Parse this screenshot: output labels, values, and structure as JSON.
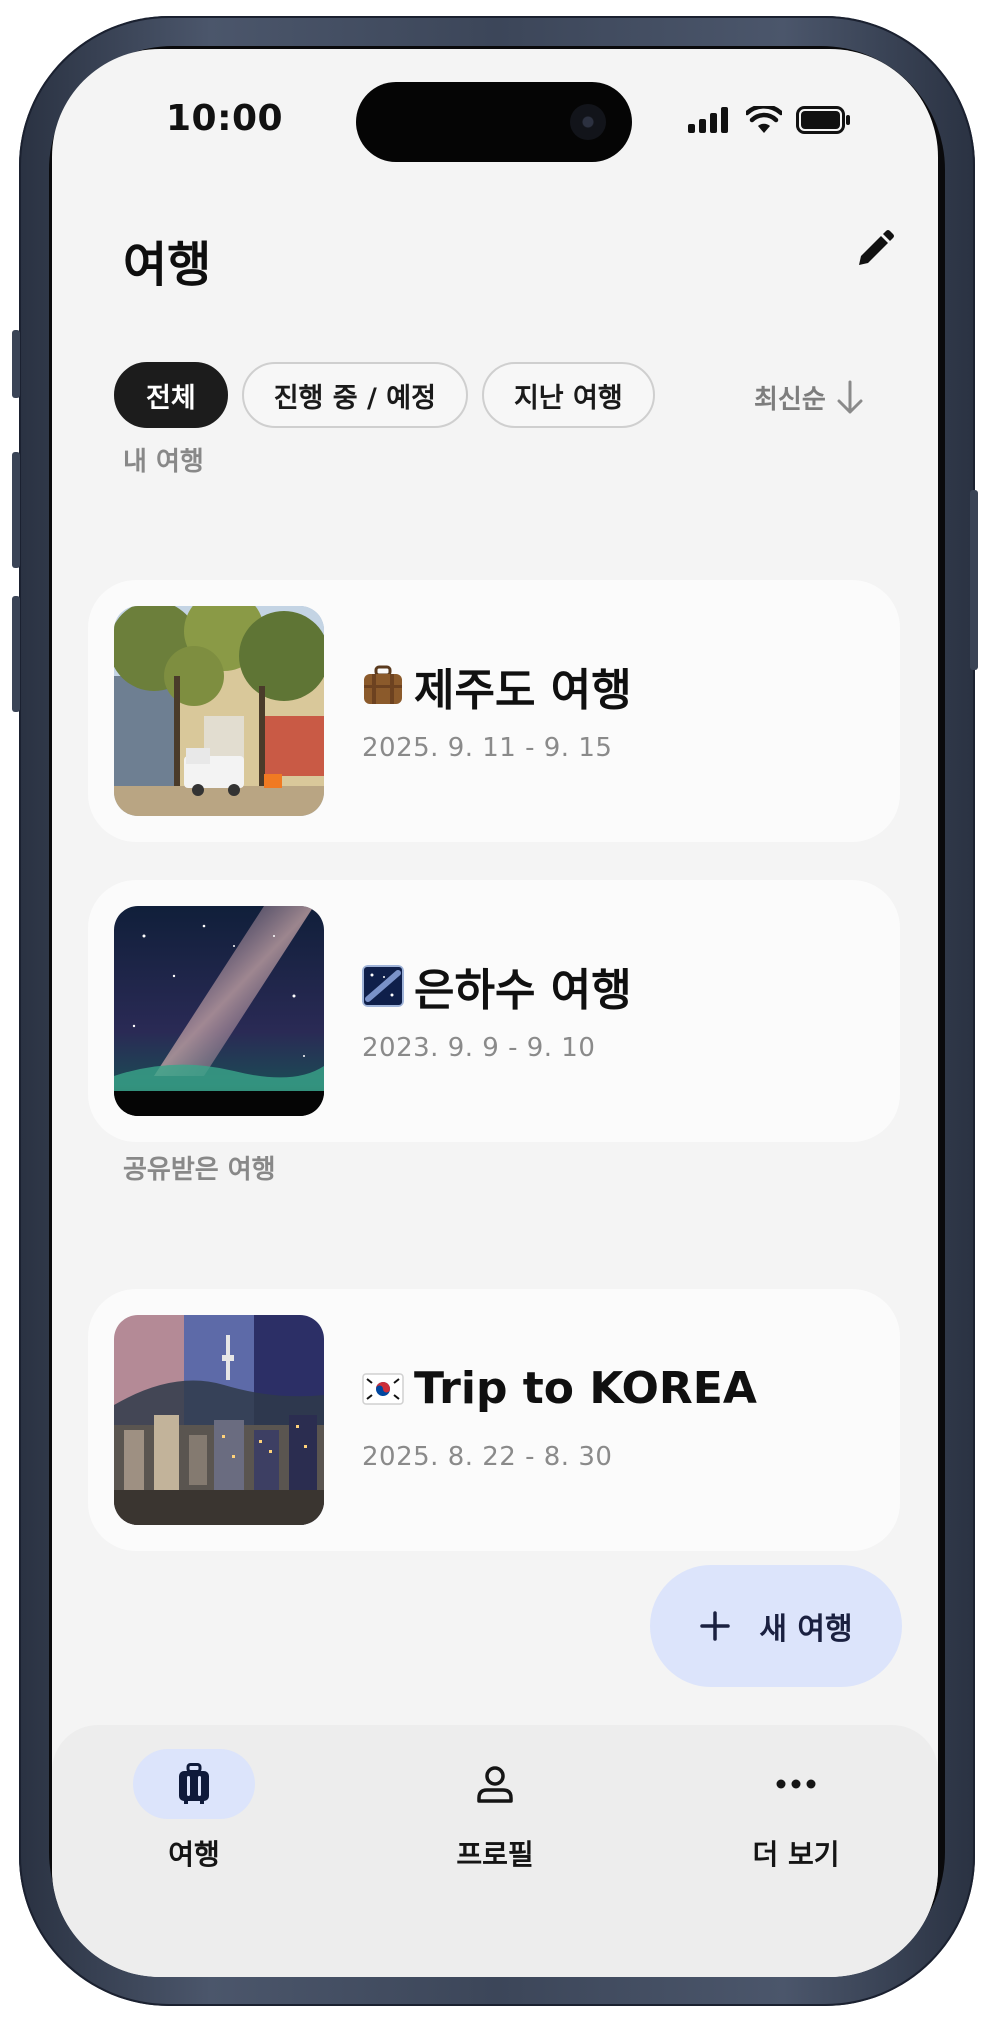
{
  "status_bar": {
    "time": "10:00"
  },
  "header": {
    "title": "여행",
    "edit_icon": "pencil-icon"
  },
  "filters": [
    {
      "label": "전체",
      "active": true
    },
    {
      "label": "진행 중 / 예정",
      "active": false
    },
    {
      "label": "지난 여행",
      "active": false
    }
  ],
  "sort": {
    "label": "최신순",
    "icon": "arrow-down-icon"
  },
  "sections": {
    "my_trips": {
      "label": "내 여행"
    },
    "shared_trips": {
      "label": "공유받은 여행"
    }
  },
  "trips": [
    {
      "emoji": "luggage",
      "title": "제주도 여행",
      "dates": "2025. 9. 11 - 9. 15"
    },
    {
      "emoji": "milky-way",
      "title": "은하수 여행",
      "dates": "2023. 9. 9 - 9. 10"
    },
    {
      "emoji": "korea-flag",
      "title": "Trip to KOREA",
      "dates": "2025. 8. 22 - 8. 30"
    }
  ],
  "fab": {
    "label": "새 여행",
    "icon": "plus-icon"
  },
  "bottom_nav": [
    {
      "label": "여행",
      "icon": "suitcase-icon",
      "active": true
    },
    {
      "label": "프로필",
      "icon": "person-icon",
      "active": false
    },
    {
      "label": "더 보기",
      "icon": "more-dots-icon",
      "active": false
    }
  ],
  "colors": {
    "screen_bg": "#f4f4f4",
    "card_bg": "#fbfbfb",
    "chip_active": "#1c1c1c",
    "fab_bg": "#dce4fb",
    "nav_active_pill": "#dce4fb",
    "nav_bg": "#ededed"
  }
}
